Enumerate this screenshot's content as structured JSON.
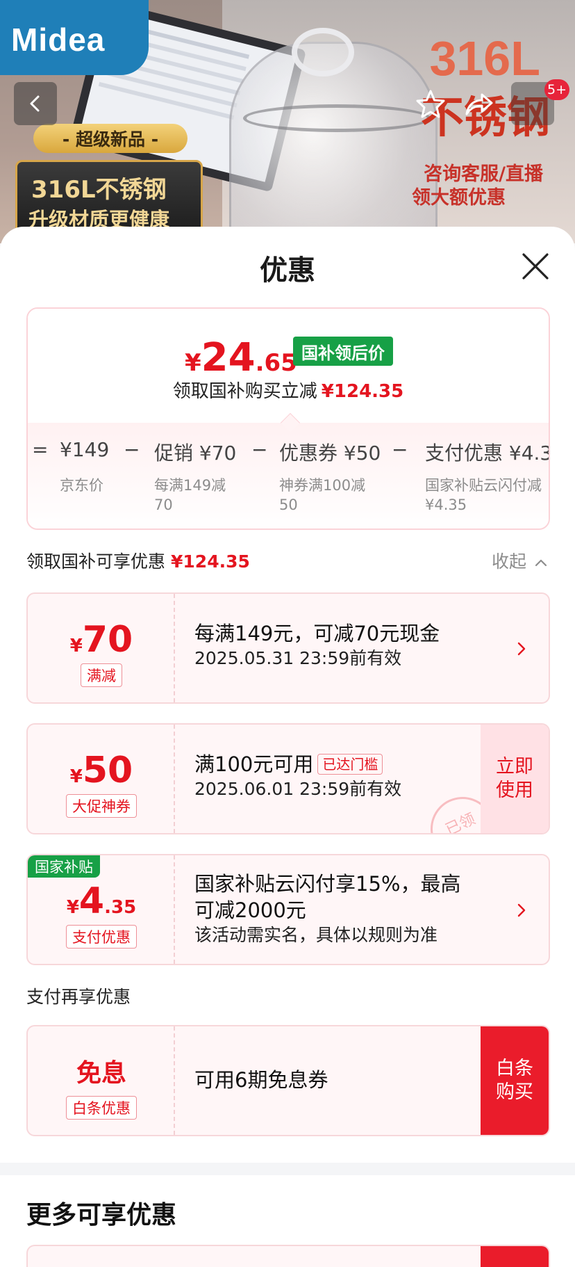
{
  "hero": {
    "brand": "Midea",
    "badge_new": "- 超级新品 -",
    "box_line1": "316L不锈钢",
    "box_line2": "升级材质更健康",
    "promo_316": "316L",
    "promo_steel": "不锈钢",
    "promo_consult": "咨询客服/直播",
    "promo_get": "领大额优惠",
    "notif_count": "5+"
  },
  "sheet": {
    "title": "优惠"
  },
  "price": {
    "symbol": "¥",
    "int": "24",
    "dec": ".65",
    "tag": "国补领后价",
    "reduce_text": "领取国补购买立减",
    "reduce_amount": "¥124.35"
  },
  "calc": {
    "eq": "=",
    "base": "¥149",
    "base_label": "京东价",
    "minus": "−",
    "promo": "促销 ¥70",
    "promo_sub": "每满149减\n70",
    "coupon": "优惠券 ¥50",
    "coupon_sub": "神券满100减\n50",
    "pay": "支付优惠 ¥4.3",
    "pay_sub": "国家补贴云闪付减\n¥4.35"
  },
  "section1": {
    "label": "领取国补可享优惠",
    "amount": "¥124.35",
    "collapse": "收起"
  },
  "coupons": [
    {
      "symbol": "¥",
      "int": "70",
      "dec": "",
      "kind": "满减",
      "title": "每满149元，可减70元现金",
      "sub": "2025.05.31 23:59前有效"
    },
    {
      "symbol": "¥",
      "int": "50",
      "dec": "",
      "kind": "大促神券",
      "title": "满100元可用",
      "reached": "已达门槛",
      "sub": "2025.06.01 23:59前有效",
      "action": "立即\n使用",
      "stamp": "已领"
    },
    {
      "corner": "国家补贴",
      "symbol": "¥",
      "int": "4",
      "dec": ".35",
      "kind": "支付优惠",
      "title": "国家补贴云闪付享15%，最高可减2000元",
      "sub": "该活动需实名，具体以规则为准"
    }
  ],
  "section2": {
    "label": "支付再享优惠"
  },
  "interest": {
    "title": "免息",
    "kind": "白条优惠",
    "text": "可用6期免息券",
    "action": "白条\n购买"
  },
  "more": {
    "title": "更多可享优惠"
  },
  "colors": {
    "accent_red": "#e4141f",
    "gov_green": "#17a046",
    "brand_blue": "#1f7fb8"
  }
}
